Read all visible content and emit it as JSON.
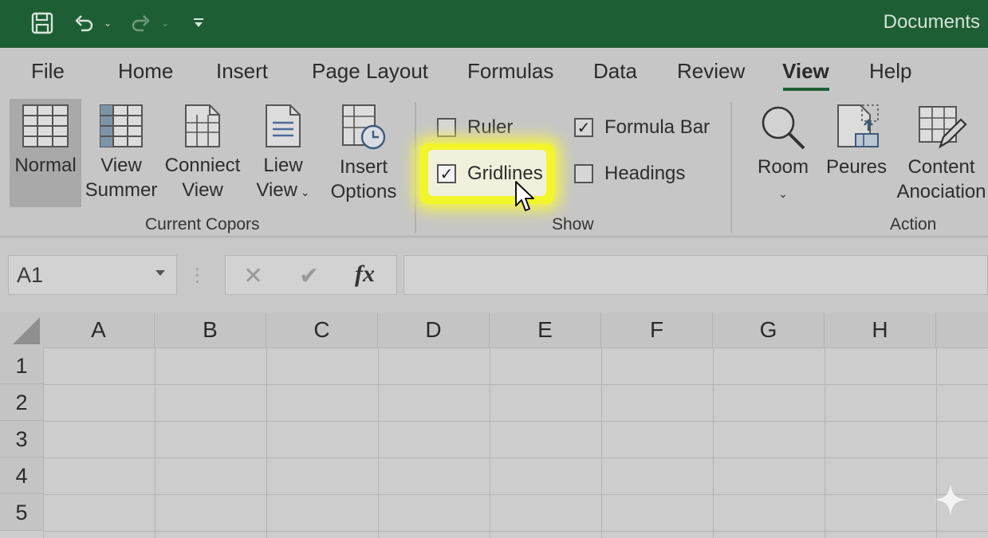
{
  "title_bar": {
    "doc_title": "Documents",
    "icons": [
      "save-icon",
      "undo-icon",
      "redo-icon",
      "customize-qat-icon"
    ]
  },
  "tabs": [
    "File",
    "Home",
    "Insert",
    "Page Layout",
    "Formulas",
    "Data",
    "Review",
    "View",
    "Help"
  ],
  "active_tab": "View",
  "ribbon": {
    "current_group": {
      "label": "Current Copors",
      "buttons": [
        {
          "line1": "Normal",
          "line2": "",
          "icon": "normal-view-icon",
          "selected": true
        },
        {
          "line1": "View",
          "line2": "Summer",
          "icon": "page-break-view-icon"
        },
        {
          "line1": "Conniect",
          "line2": "View",
          "icon": "page-layout-view-icon"
        },
        {
          "line1": "Liew",
          "line2": "View",
          "icon": "custom-view-icon"
        },
        {
          "line1": "Insert",
          "line2": "Options",
          "icon": "insert-options-icon"
        }
      ]
    },
    "show_group": {
      "label": "Show",
      "ruler": {
        "label": "Ruler",
        "checked": false
      },
      "formula_bar": {
        "label": "Formula Bar",
        "checked": true
      },
      "gridlines": {
        "label": "Gridlines",
        "checked": true,
        "highlighted": true
      },
      "headings": {
        "label": "Headings",
        "checked": false
      }
    },
    "action_group": {
      "label": "Action",
      "buttons": [
        {
          "line1": "Room",
          "icon": "zoom-icon"
        },
        {
          "line1": "Peures",
          "icon": "freeze-panes-icon"
        },
        {
          "line1": "Content",
          "line2": "Anociation",
          "icon": "edit-table-icon"
        }
      ]
    }
  },
  "formula_bar": {
    "name_box": "A1",
    "cancel_glyph": "✕",
    "enter_glyph": "✔",
    "fx_label": "fx",
    "value": ""
  },
  "grid": {
    "columns": [
      "A",
      "B",
      "C",
      "D",
      "E",
      "F",
      "G",
      "H"
    ],
    "rows": [
      "1",
      "2",
      "3",
      "4",
      "5"
    ]
  },
  "colors": {
    "title_bar": "#1e5e35",
    "highlight": "#f2f52a",
    "ribbon": "#c6c6c6"
  }
}
